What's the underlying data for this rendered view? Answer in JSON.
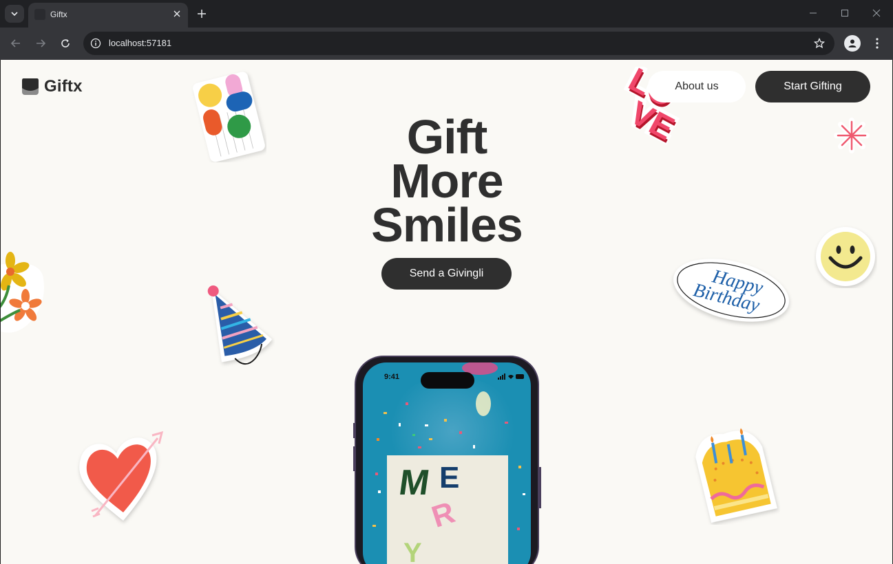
{
  "browser": {
    "tab_title": "Giftx",
    "url": "localhost:57181"
  },
  "nav": {
    "logo_text": "Giftx",
    "about_label": "About us",
    "start_label": "Start Gifting"
  },
  "hero": {
    "title_line1": "Gift",
    "title_line2": "More",
    "title_line3": "Smiles",
    "cta_label": "Send a Givingli"
  },
  "stickers": {
    "happy_birthday_line1": "Happy",
    "happy_birthday_line2": "Birthday",
    "love_text": "LOVE"
  },
  "phone": {
    "status_time": "9:41",
    "card_letters": [
      "M",
      "E",
      "R",
      "Y"
    ]
  },
  "colors": {
    "accent_dark": "#2f2f2f",
    "page_bg": "#faf9f5",
    "phone_screen": "#1b8fb3"
  }
}
